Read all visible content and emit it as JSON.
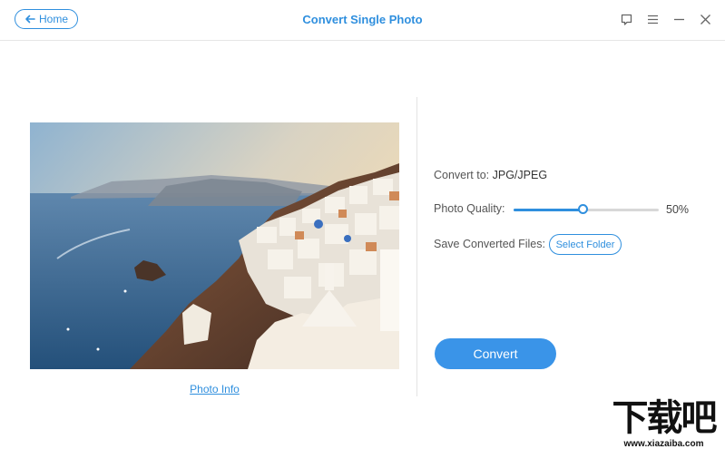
{
  "header": {
    "home_label": "Home",
    "title": "Convert Single Photo",
    "icons": [
      "feedback-icon",
      "menu-icon",
      "minimize-icon",
      "close-icon"
    ]
  },
  "photo": {
    "info_link": "Photo Info"
  },
  "settings": {
    "convert_to_label": "Convert to:",
    "convert_to_value": "JPG/JPEG",
    "quality_label": "Photo Quality:",
    "quality_value": "50%",
    "quality_fraction": 0.48,
    "save_label": "Save Converted Files:",
    "select_folder": "Select Folder"
  },
  "actions": {
    "convert": "Convert"
  },
  "watermark": {
    "text": "下载吧",
    "url": "www.xiazaiba.com"
  },
  "colors": {
    "accent": "#2f8fde",
    "button": "#3a94e8"
  }
}
